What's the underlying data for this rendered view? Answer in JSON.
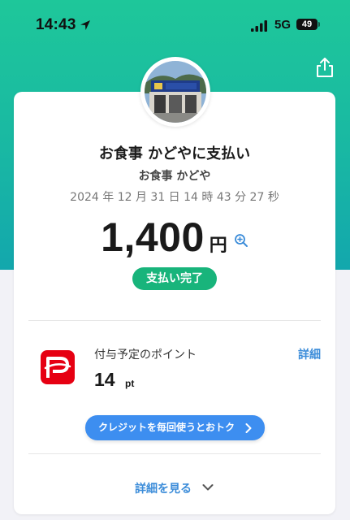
{
  "status_bar": {
    "time": "14:43",
    "network": "5G",
    "battery": "49"
  },
  "payment": {
    "title": "お食事 かどやに支払い",
    "merchant": "お食事 かどや",
    "datetime": "2024 年 12 月 31 日 14 時 43 分 27 秒",
    "amount": "1,400",
    "currency": "円",
    "status": "支払い完了"
  },
  "points": {
    "label": "付与予定のポイント",
    "detail_link": "詳細",
    "value": "14",
    "unit": "pt"
  },
  "promo": {
    "banner": "クレジットを毎回使うとおトク"
  },
  "footer": {
    "see_details": "詳細を見る"
  },
  "colors": {
    "hero_top": "#1ec79a",
    "hero_bottom": "#13a7ad",
    "status_green": "#18b47b",
    "link_blue": "#3b8cd9",
    "banner_blue": "#3d8ef0",
    "paypay_red": "#e60012"
  },
  "icons": {
    "location": "location-arrow-icon",
    "signal": "cellular-signal-icon",
    "share": "share-icon",
    "zoom": "zoom-in-icon",
    "chevron": "chevron-down-icon",
    "banner_arrow": "chevron-right-icon"
  }
}
